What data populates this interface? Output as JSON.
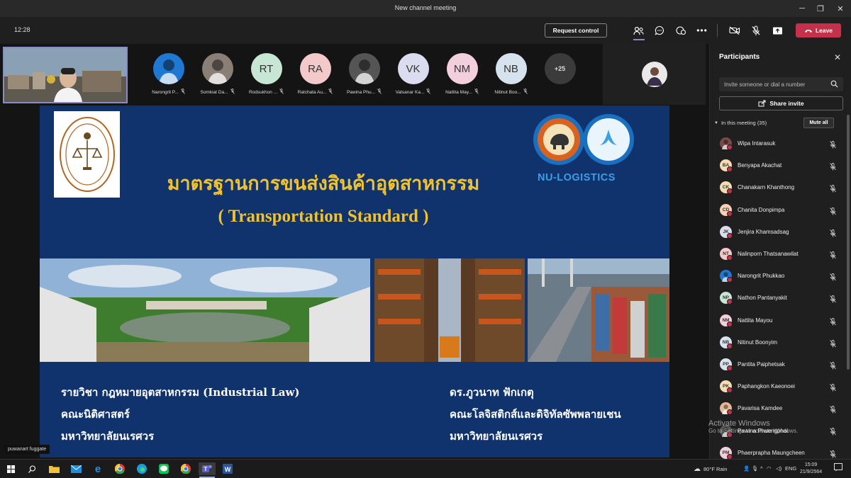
{
  "window": {
    "title": "New channel meeting"
  },
  "toolbar": {
    "time": "12:28",
    "request_control": "Request control",
    "leave": "Leave"
  },
  "strip": {
    "participants": [
      {
        "initials": "",
        "name": "Narongrit P...",
        "color": "#1f78d1",
        "photo": true
      },
      {
        "initials": "",
        "name": "Somkiat Da...",
        "color": "#8a7f77",
        "photo": true
      },
      {
        "initials": "RT",
        "name": "Rodsukhon ...",
        "color": "#c8e6d4"
      },
      {
        "initials": "RA",
        "name": "Ratchata Au...",
        "color": "#f4c9c9"
      },
      {
        "initials": "",
        "name": "Pawina Phu...",
        "color": "#555555",
        "photo": true
      },
      {
        "initials": "VK",
        "name": "Vatsanar Ka...",
        "color": "#dcdcf0"
      },
      {
        "initials": "NM",
        "name": "Nattita May...",
        "color": "#f2cfdc"
      },
      {
        "initials": "NB",
        "name": "Nitinut Boo...",
        "color": "#d6e2ee"
      }
    ],
    "more": "+25"
  },
  "slide": {
    "title_th": "มาตรฐานการขนส่งสินค้าอุตสาหกรรม",
    "title_en": "( Transportation Standard )",
    "nu_logo_text": "NU-LOGISTICS",
    "left_lines": [
      "รายวิชา กฎหมายอุตสาหกรรม (Industrial Law)",
      "คณะนิติศาสตร์",
      "มหาวิทยาลัยนเรศวร"
    ],
    "right_lines": [
      "ดร.ภูวนาท ฟักเกตุ",
      "คณะโลจิสติกส์และดิจิทัลซัพพลายเชน",
      "มหาวิทยาลัยนเรศวร"
    ]
  },
  "presenter_tag": "puwanart fuggate",
  "panel": {
    "title": "Participants",
    "invite_placeholder": "Invite someone or dial a number",
    "share_invite": "Share invite",
    "in_meeting": "In this meeting (35)",
    "mute_all": "Mute all",
    "people": [
      {
        "initials": "",
        "name": "Wipa Intarasuk",
        "color": "#7a4a4a"
      },
      {
        "initials": "BA",
        "name": "Benyapa Akachat",
        "color": "#f6dcb2"
      },
      {
        "initials": "CK",
        "name": "Chanakarn Khanthong",
        "color": "#f6dcb2"
      },
      {
        "initials": "CD",
        "name": "Chanita Donpimpa",
        "color": "#f6d1b8"
      },
      {
        "initials": "JK",
        "name": "Jenjira Khamsadsag",
        "color": "#dcdcf0"
      },
      {
        "initials": "NT",
        "name": "Nalinporn Thatsanawilat",
        "color": "#f4c9c9"
      },
      {
        "initials": "",
        "name": "Narongrit Phukkao",
        "color": "#1f78d1"
      },
      {
        "initials": "NP",
        "name": "Nathon Pantanyakit",
        "color": "#c8e6d4"
      },
      {
        "initials": "NM",
        "name": "Nattita Mayou",
        "color": "#f2cfdc"
      },
      {
        "initials": "NB",
        "name": "Nitinut Boonyim",
        "color": "#d6e2ee"
      },
      {
        "initials": "PP",
        "name": "Pantita Paiphetsak",
        "color": "#d6e2ee"
      },
      {
        "initials": "PK",
        "name": "Paphangkon Kaeonoei",
        "color": "#f6dcb2"
      },
      {
        "initials": "",
        "name": "Pavarisa Kamdee",
        "color": "#e6b89a"
      },
      {
        "initials": "",
        "name": "Pawina Phuengphai",
        "color": "#555555"
      },
      {
        "initials": "PM",
        "name": "Phaerprapha Maungcheen",
        "color": "#f2cfdc"
      }
    ]
  },
  "watermark": {
    "line1": "Activate Windows",
    "line2": "Go to Settings to activate Windows."
  },
  "taskbar": {
    "weather": "80°F  Rain",
    "lang": "ENG",
    "time": "15:09",
    "date": "21/9/2564"
  }
}
